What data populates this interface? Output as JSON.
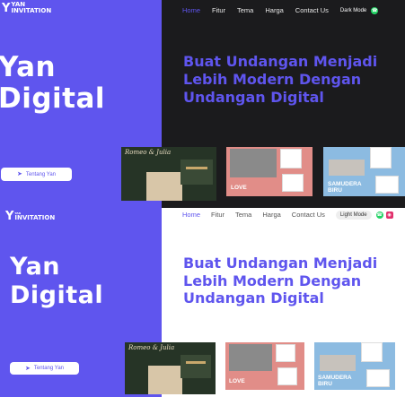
{
  "brand": {
    "logo_mark": "Y",
    "logo_line1": "YAN",
    "logo_line2": "INVITATION",
    "logo_small": "YAN",
    "name_line1": "Yan",
    "name_line2": "Digital"
  },
  "nav": {
    "items": [
      "Home",
      "Fitur",
      "Tema",
      "Harga",
      "Contact Us"
    ],
    "active": "Home"
  },
  "dark_mode_label": "Dark Mode",
  "light_mode_label": "Light Mode",
  "hero": {
    "line1": "Buat Undangan Menjadi",
    "line2": "Lebih Modern Dengan",
    "line3": "Undangan Digital"
  },
  "about_button_label": "Tentang Yan",
  "cards": [
    {
      "theme": "green",
      "script_title": "Romeo & Julia"
    },
    {
      "theme": "pink",
      "label": "LOVE"
    },
    {
      "theme": "blue",
      "label_line1": "SAMUDERA",
      "label_line2": "BIRU"
    }
  ],
  "colors": {
    "brand": "#5f55ee",
    "dark_bg": "#1b1b1d",
    "light_bg": "#ffffff",
    "whatsapp": "#25d366"
  },
  "icons": [
    "send-icon",
    "whatsapp-icon",
    "instagram-icon"
  ]
}
